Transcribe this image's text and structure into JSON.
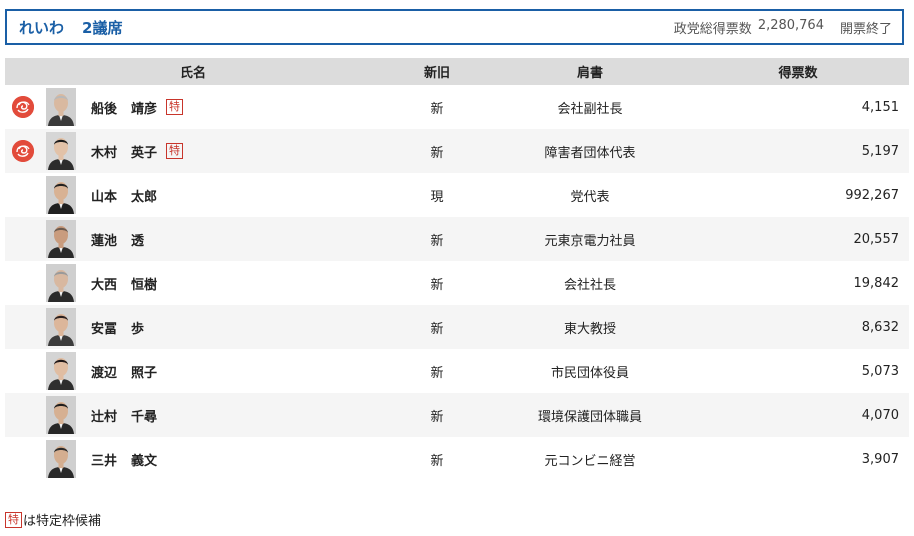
{
  "header": {
    "party": "れいわ",
    "seats": "2議席",
    "total_label": "政党総得票数",
    "total_votes": "2,280,764",
    "status": "開票終了"
  },
  "table": {
    "columns": [
      "氏名",
      "新旧",
      "肩書",
      "得票数"
    ],
    "rows": [
      {
        "elected": true,
        "family": "船後",
        "given": "靖彦",
        "toku": true,
        "status": "新",
        "title": "会社副社長",
        "votes": "4,151",
        "photo": {
          "skin": "#d9b9a0",
          "hair": "#b9b9b9",
          "suit": "#3a3a3a",
          "bg": "#cfcfcf"
        }
      },
      {
        "elected": true,
        "family": "木村",
        "given": "英子",
        "toku": true,
        "status": "新",
        "title": "障害者団体代表",
        "votes": "5,197",
        "photo": {
          "skin": "#e2c2a8",
          "hair": "#1c1c1c",
          "suit": "#2c2c2c",
          "bg": "#d6d6d6"
        }
      },
      {
        "elected": false,
        "family": "山本",
        "given": "太郎",
        "toku": false,
        "status": "現",
        "title": "党代表",
        "votes": "992,267",
        "photo": {
          "skin": "#d8b294",
          "hair": "#222222",
          "suit": "#1f1f1f",
          "bg": "#cfcfcf"
        }
      },
      {
        "elected": false,
        "family": "蓮池",
        "given": "透",
        "toku": false,
        "status": "新",
        "title": "元東京電力社員",
        "votes": "20,557",
        "photo": {
          "skin": "#c99c7e",
          "hair": "#6b5a4e",
          "suit": "#2a2a2a",
          "bg": "#d0d0d0"
        }
      },
      {
        "elected": false,
        "family": "大西",
        "given": "恒樹",
        "toku": false,
        "status": "新",
        "title": "会社社長",
        "votes": "19,842",
        "photo": {
          "skin": "#d8b8a0",
          "hair": "#9a9a9a",
          "suit": "#2b2b2b",
          "bg": "#cfcfcf"
        }
      },
      {
        "elected": false,
        "family": "安冨",
        "given": "歩",
        "toku": false,
        "status": "新",
        "title": "東大教授",
        "votes": "8,632",
        "photo": {
          "skin": "#dcb69a",
          "hair": "#2a2020",
          "suit": "#3b3b3b",
          "bg": "#d0d0d0"
        }
      },
      {
        "elected": false,
        "family": "渡辺",
        "given": "照子",
        "toku": false,
        "status": "新",
        "title": "市民団体役員",
        "votes": "5,073",
        "photo": {
          "skin": "#e0bda2",
          "hair": "#201818",
          "suit": "#2e2e2e",
          "bg": "#d4d4d4"
        }
      },
      {
        "elected": false,
        "family": "辻村",
        "given": "千尋",
        "toku": false,
        "status": "新",
        "title": "環境保護団体職員",
        "votes": "4,070",
        "photo": {
          "skin": "#d6b092",
          "hair": "#1e1e1e",
          "suit": "#262626",
          "bg": "#cfcfcf"
        }
      },
      {
        "elected": false,
        "family": "三井",
        "given": "義文",
        "toku": false,
        "status": "新",
        "title": "元コンビニ経営",
        "votes": "3,907",
        "photo": {
          "skin": "#d4ae90",
          "hair": "#2a2a2a",
          "suit": "#2a2a2a",
          "bg": "#cfcfcf"
        }
      }
    ]
  },
  "badges": {
    "toku_label": "特",
    "elected_icon": "rose-elected-icon"
  },
  "footnote": {
    "badge": "特",
    "text": "は特定枠候補"
  },
  "colors": {
    "accent": "#1a5fa6",
    "elected": "#e24b3b",
    "toku": "#c8352b",
    "header_bg": "#dcdcdc",
    "row_alt": "#f5f5f5"
  }
}
